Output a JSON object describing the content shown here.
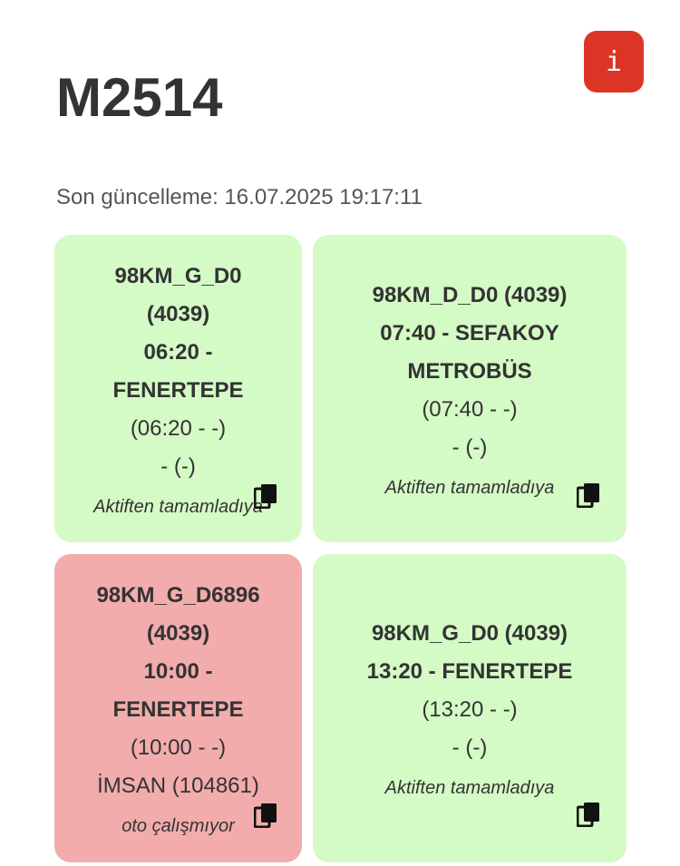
{
  "header": {
    "title": "M2514",
    "info_label": "i",
    "last_updated": "Son güncelleme: 16.07.2025 19:17:11"
  },
  "cards": [
    {
      "lines_bold": [
        "98KM_G_D0",
        "(4039)",
        "06:20 -",
        "FENERTEPE"
      ],
      "lines_normal": [
        "(06:20 - -)",
        "- (-)"
      ],
      "status": "Aktiften tamamladıya",
      "color": "#d4fac5"
    },
    {
      "lines_bold": [
        "98KM_D_D0 (4039)",
        "07:40 - SEFAKOY",
        "METROBÜS"
      ],
      "lines_normal": [
        "(07:40 - -)",
        "- (-)"
      ],
      "status": "Aktiften tamamladıya",
      "color": "#d4fac5"
    },
    {
      "lines_bold": [
        "98KM_G_D6896",
        "(4039)",
        "10:00 -",
        "FENERTEPE"
      ],
      "lines_normal": [
        "(10:00 - -)",
        "İMSAN (104861)"
      ],
      "status": "oto çalışmıyor",
      "color": "#f2acac"
    },
    {
      "lines_bold": [
        "98KM_G_D0 (4039)",
        "13:20 - FENERTEPE"
      ],
      "lines_normal": [
        "(13:20 - -)",
        "- (-)"
      ],
      "status": "Aktiften tamamladıya",
      "color": "#d4fac5"
    }
  ],
  "icons": {
    "info": "info-icon",
    "copy": "copy-icon"
  }
}
